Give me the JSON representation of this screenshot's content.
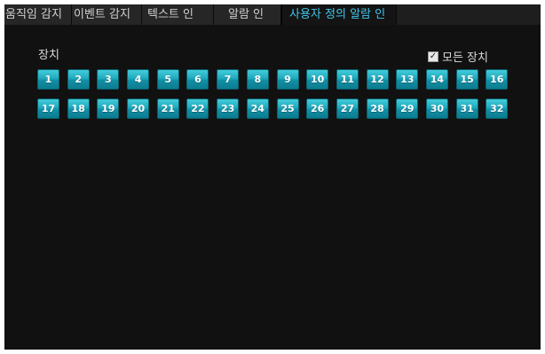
{
  "tabs": [
    {
      "label": "움직임 감지",
      "active": false
    },
    {
      "label": "이벤트 감지",
      "active": false
    },
    {
      "label": "텍스트 인",
      "active": false
    },
    {
      "label": "알람 인",
      "active": false
    },
    {
      "label": "사용자 정의 알람 인",
      "active": true
    }
  ],
  "device_group": {
    "label": "장치",
    "all_devices_label": "모든 장치",
    "all_devices_checked": true
  },
  "devices": [
    "1",
    "2",
    "3",
    "4",
    "5",
    "6",
    "7",
    "8",
    "9",
    "10",
    "11",
    "12",
    "13",
    "14",
    "15",
    "16",
    "17",
    "18",
    "19",
    "20",
    "21",
    "22",
    "23",
    "24",
    "25",
    "26",
    "27",
    "28",
    "29",
    "30",
    "31",
    "32"
  ],
  "colors": {
    "background": "#111111",
    "active_tab_text": "#3fc6ea",
    "device_button": "#20a9bd"
  }
}
